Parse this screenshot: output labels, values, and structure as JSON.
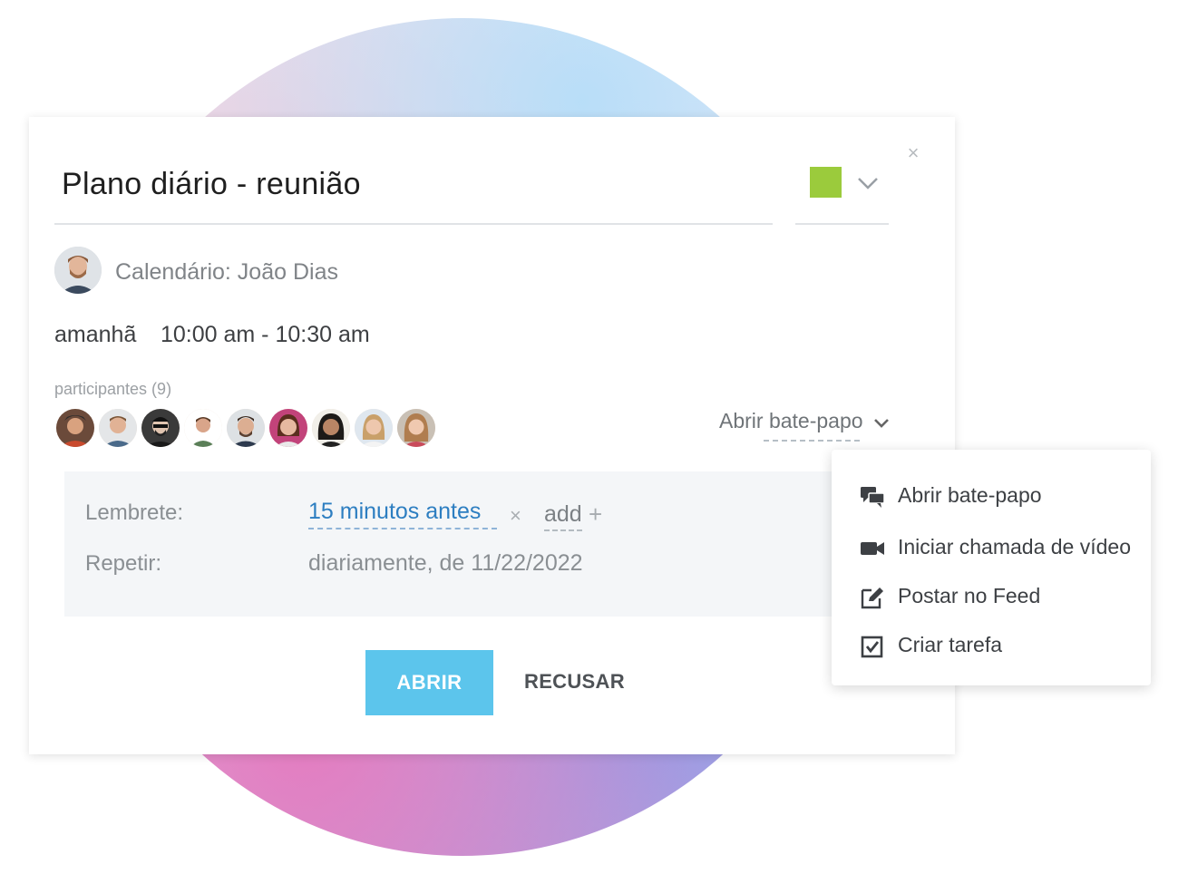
{
  "event": {
    "title": "Plano diário - reunião",
    "color": "#9bcb3c",
    "close_label": "×",
    "owner_label": "Calendário: João Dias",
    "day": "amanhã",
    "time": "10:00 am - 10:30 am",
    "participants_label": "participantes (9)",
    "participant_count": 9,
    "chat_toggle_label": "Abrir bate-papo"
  },
  "reminder": {
    "label": "Lembrete:",
    "value": "15 minutos antes",
    "remove": "×",
    "add_label": "add",
    "add_plus": "+"
  },
  "repeat": {
    "label": "Repetir:",
    "value": "diariamente, de 11/22/2022"
  },
  "buttons": {
    "open": "ABRIR",
    "decline": "RECUSAR"
  },
  "menu": {
    "items": [
      {
        "label": "Abrir bate-papo",
        "icon": "chat-icon"
      },
      {
        "label": "Iniciar chamada de vídeo",
        "icon": "video-camera-icon"
      },
      {
        "label": "Postar no Feed",
        "icon": "edit-post-icon"
      },
      {
        "label": "Criar tarefa",
        "icon": "task-checkbox-icon"
      }
    ]
  }
}
